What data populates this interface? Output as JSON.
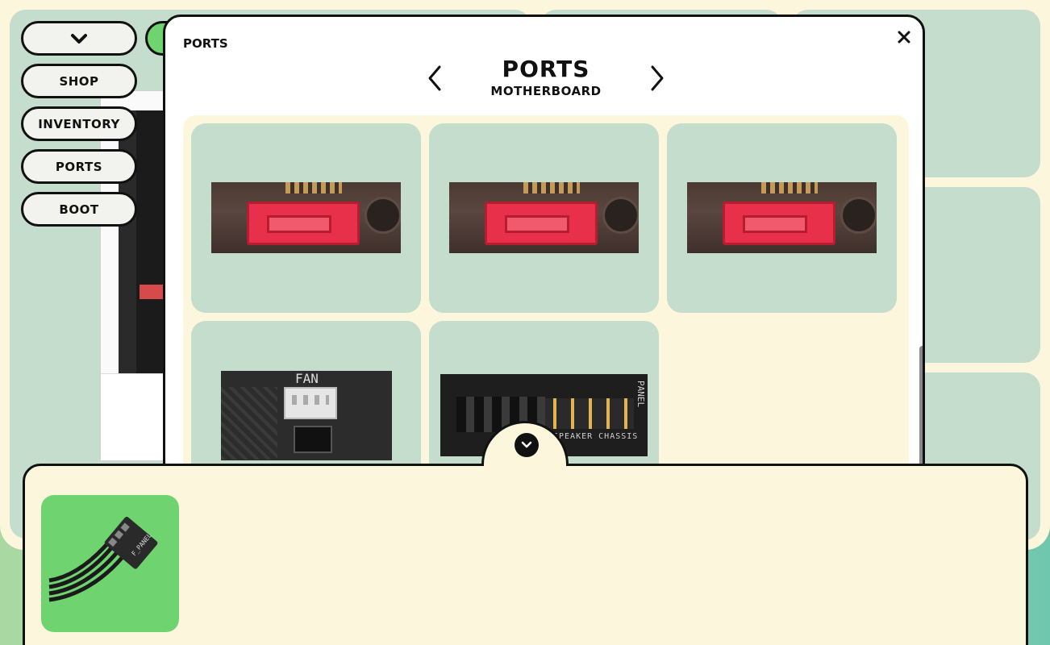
{
  "nav": {
    "items": [
      {
        "label": "",
        "icon": "chevron-down-icon"
      },
      {
        "label": "SHOP"
      },
      {
        "label": "INVENTORY"
      },
      {
        "label": "PORTS"
      },
      {
        "label": "BOOT"
      }
    ]
  },
  "modal": {
    "tag": "PORTS",
    "close_icon": "close-icon",
    "title": "PORTS",
    "subtitle": "MOTHERBOARD",
    "prev_icon": "chevron-left-icon",
    "next_icon": "chevron-right-icon",
    "ports": [
      {
        "type": "sata-port-image"
      },
      {
        "type": "sata-port-image"
      },
      {
        "type": "sata-port-image"
      },
      {
        "type": "fan-header-image",
        "label": "FAN"
      },
      {
        "type": "front-panel-header-image",
        "label_side": "PANEL",
        "label_bottom": "SPEAKER  CHASSIS"
      }
    ]
  },
  "tray": {
    "toggle_icon": "chevron-down-icon",
    "items": [
      {
        "type": "front-panel-cable-image",
        "cable_label": "F_PANEL"
      }
    ]
  },
  "colors": {
    "panel_green": "#c5ddcc",
    "cream": "#fcf7dc",
    "accent_green": "#6fd36f",
    "sata_red": "#e8304a"
  }
}
